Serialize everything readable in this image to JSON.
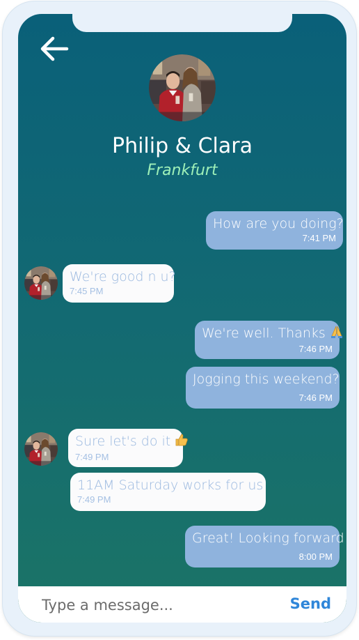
{
  "header": {
    "back_icon": "arrow-left-icon",
    "contact_name": "Philip & Clara",
    "location": "Frankfurt"
  },
  "messages": [
    {
      "direction": "out",
      "text": "How are you doing?",
      "time": "7:41 PM"
    },
    {
      "direction": "in",
      "text": "We're good n u?",
      "time": "7:45 PM"
    },
    {
      "direction": "out",
      "text": "We're well. Thanks",
      "emoji": "folded-hands-icon",
      "time": "7:46 PM"
    },
    {
      "direction": "out",
      "text": "Jogging this weekend?",
      "time": "7:46 PM"
    },
    {
      "direction": "in",
      "text": "Sure let's do it",
      "emoji": "thumbs-up-icon",
      "time": "7:49 PM"
    },
    {
      "direction": "in",
      "text": "11AM Saturday works for us",
      "time": "7:49 PM"
    },
    {
      "direction": "out",
      "text": "Great! Looking forward",
      "time": "8:00 PM"
    }
  ],
  "composer": {
    "placeholder": "Type a message...",
    "send_label": "Send"
  },
  "colors": {
    "screen_top": "#0a6079",
    "screen_bottom": "#1b7466",
    "outgoing_bubble": "#8fb3dd",
    "incoming_bubble": "#fbfbfc",
    "incoming_text": "#9ab8df",
    "location_text": "#9ef0b8",
    "send_button": "#2f86d9"
  }
}
